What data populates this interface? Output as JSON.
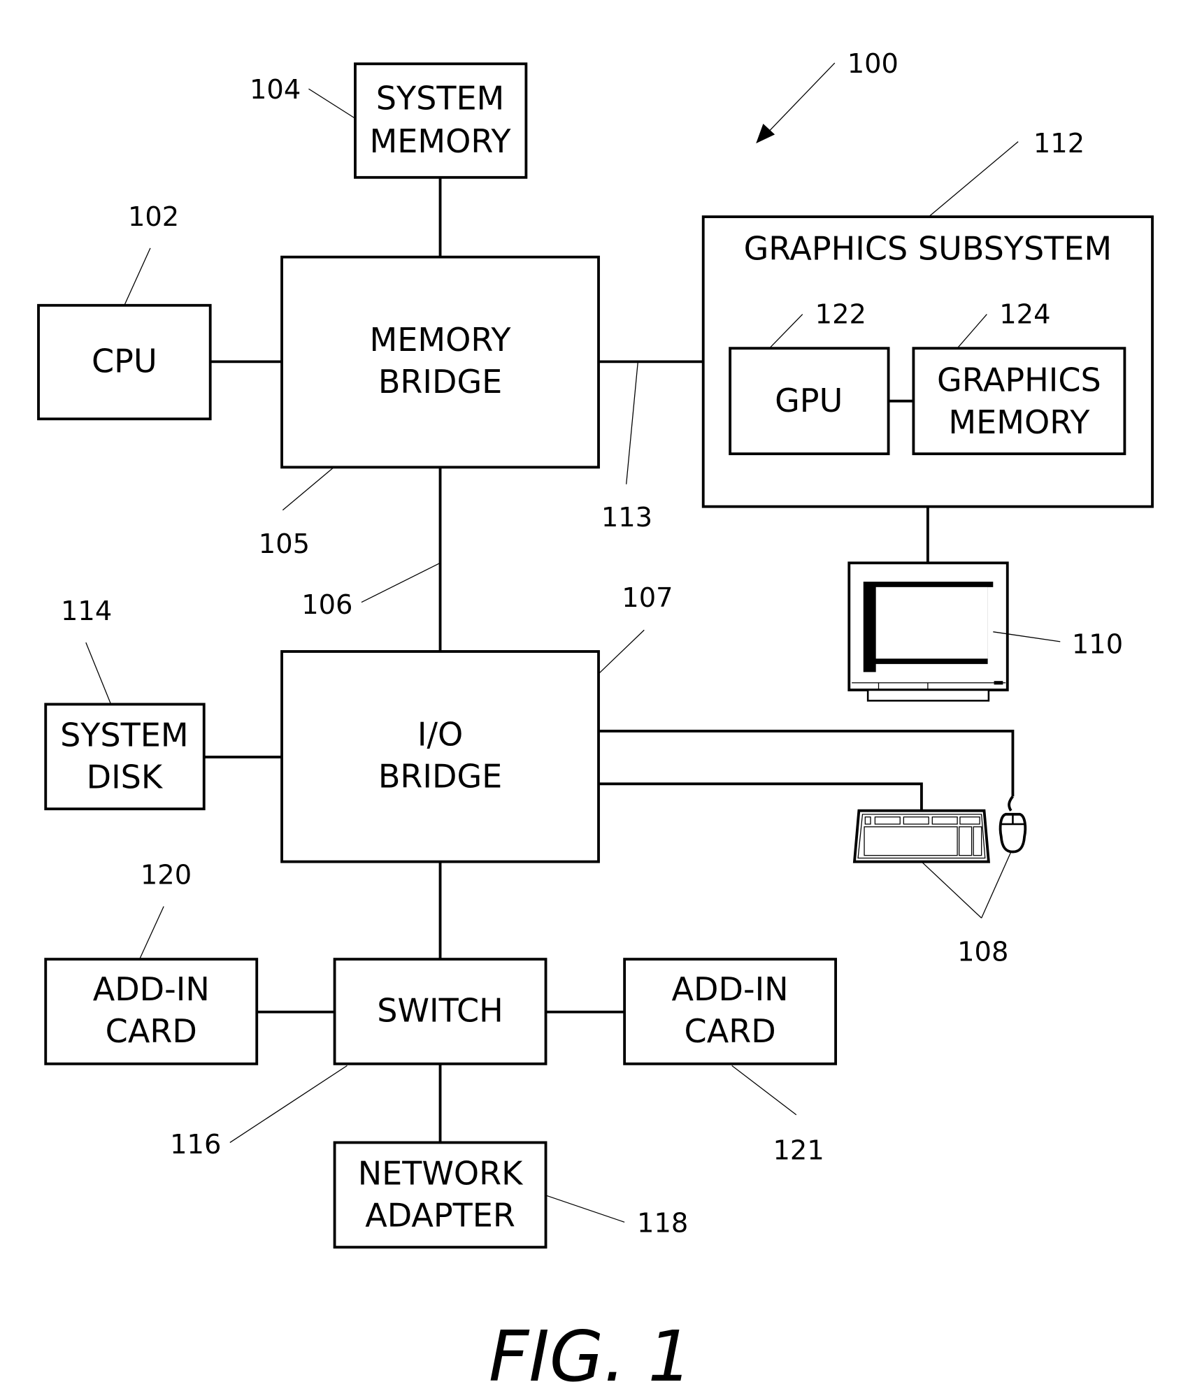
{
  "figure": {
    "caption": "FIG. 1",
    "ref": "100"
  },
  "blocks": {
    "system_memory": {
      "lines": [
        "SYSTEM",
        "MEMORY"
      ],
      "ref": "104"
    },
    "cpu": {
      "lines": [
        "CPU"
      ],
      "ref": "102"
    },
    "memory_bridge": {
      "lines": [
        "MEMORY",
        "BRIDGE"
      ],
      "ref": "105"
    },
    "graphics_subsystem": {
      "title": "GRAPHICS SUBSYSTEM",
      "ref": "112"
    },
    "gpu": {
      "lines": [
        "GPU"
      ],
      "ref": "122"
    },
    "graphics_memory": {
      "lines": [
        "GRAPHICS",
        "MEMORY"
      ],
      "ref": "124"
    },
    "display": {
      "ref": "110"
    },
    "system_disk": {
      "lines": [
        "SYSTEM",
        "DISK"
      ],
      "ref": "114"
    },
    "io_bridge": {
      "lines": [
        "I/O",
        "BRIDGE"
      ],
      "ref": "107"
    },
    "input_devices": {
      "ref": "108"
    },
    "add_in_card_left": {
      "lines": [
        "ADD-IN",
        "CARD"
      ],
      "ref": "120"
    },
    "switch": {
      "lines": [
        "SWITCH"
      ],
      "ref": "116"
    },
    "add_in_card_right": {
      "lines": [
        "ADD-IN",
        "CARD"
      ],
      "ref": "121"
    },
    "network_adapter": {
      "lines": [
        "NETWORK",
        "ADAPTER"
      ],
      "ref": "118"
    }
  },
  "connections": {
    "bus_113": "113",
    "bus_106": "106"
  }
}
